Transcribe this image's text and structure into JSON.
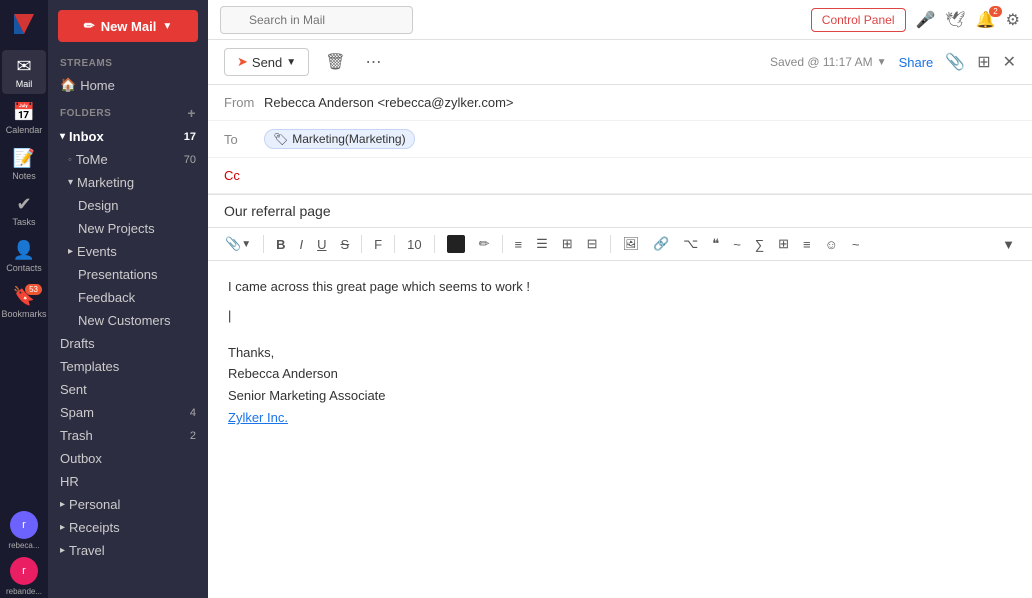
{
  "app": {
    "name": "Zylker",
    "logo": "Z"
  },
  "topbar": {
    "search_placeholder": "Search in Mail",
    "control_panel": "Control Panel"
  },
  "nav": {
    "items": [
      {
        "id": "mail",
        "label": "Mail",
        "icon": "✉",
        "active": true
      },
      {
        "id": "calendar",
        "label": "Calendar",
        "icon": "📅",
        "active": false
      },
      {
        "id": "notes",
        "label": "Notes",
        "icon": "📝",
        "active": false
      },
      {
        "id": "tasks",
        "label": "Tasks",
        "icon": "✓",
        "active": false
      },
      {
        "id": "contacts",
        "label": "Contacts",
        "icon": "👤",
        "active": false
      },
      {
        "id": "bookmarks",
        "label": "Bookmarks",
        "icon": "🔖",
        "active": false,
        "badge": "53"
      },
      {
        "id": "recent1",
        "label": "rebeca...",
        "icon": "●",
        "active": false
      },
      {
        "id": "recent2",
        "label": "rebande...",
        "icon": "●",
        "active": false
      }
    ]
  },
  "sidebar": {
    "new_mail_label": "New Mail",
    "streams_label": "STREAMS",
    "folders_label": "FOLDERS",
    "home_label": "Home",
    "inbox_label": "Inbox",
    "inbox_count": "17",
    "tome_label": "ToMe",
    "tome_count": "70",
    "marketing_label": "Marketing",
    "design_label": "Design",
    "new_projects_label": "New Projects",
    "events_label": "Events",
    "presentations_label": "Presentations",
    "feedback_label": "Feedback",
    "new_customers_label": "New Customers",
    "drafts_label": "Drafts",
    "templates_label": "Templates",
    "sent_label": "Sent",
    "spam_label": "Spam",
    "spam_count": "4",
    "trash_label": "Trash",
    "trash_count": "2",
    "outbox_label": "Outbox",
    "hr_label": "HR",
    "personal_label": "Personal",
    "receipts_label": "Receipts",
    "travel_label": "Travel"
  },
  "compose": {
    "send_label": "Send",
    "saved_info": "Saved @ 11:17 AM",
    "share_label": "Share",
    "from_label": "From",
    "from_value": "Rebecca Anderson <rebecca@zylker.com>",
    "to_label": "To",
    "to_value": "Marketing(Marketing)",
    "cc_label": "Cc",
    "subject": "Our referral page",
    "body_line1": "I came across this great page which seems to work !",
    "signature_line1": "Thanks,",
    "signature_line2": "Rebecca Anderson",
    "signature_line3": "Senior Marketing Associate",
    "signature_link": "Zylker Inc.",
    "cursor_visible": true,
    "font_size": "10",
    "format_buttons": [
      "📎",
      "B",
      "I",
      "U",
      "S",
      "F",
      "10",
      "■",
      "✏",
      "≡",
      "☰",
      "⊞",
      "⊟",
      "🖼",
      "🔗",
      "⌥",
      "❝",
      "≈",
      "∑",
      "⊞",
      "≡",
      "☺",
      "∿"
    ]
  }
}
